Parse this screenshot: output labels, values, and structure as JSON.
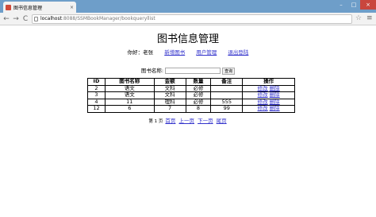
{
  "browser": {
    "tab_title": "图书信息管理",
    "tab_close": "×",
    "win_min": "–",
    "win_max": "□",
    "win_close": "×",
    "back": "←",
    "forward": "→",
    "reload": "C",
    "url_host": "localhost",
    "url_path": ":8088/SSMBookManager/bookqueryllist",
    "star": "☆",
    "menu": "≡"
  },
  "page": {
    "title": "图书信息管理",
    "greeting": "你好：老张",
    "links": [
      "新增图书",
      "用户管理",
      "退出登陆"
    ],
    "search_label": "图书名称:",
    "search_value": "",
    "search_button": "查询"
  },
  "table": {
    "headers": [
      "ID",
      "图书名称",
      "金额",
      "数量",
      "备注",
      "操作"
    ],
    "rows": [
      {
        "id": "2",
        "name": "语文",
        "amount": "文科",
        "qty": "必修",
        "note": "",
        "edit": "修改",
        "del": "删除"
      },
      {
        "id": "3",
        "name": "语文",
        "amount": "文科",
        "qty": "必修",
        "note": "",
        "edit": "修改",
        "del": "删除"
      },
      {
        "id": "4",
        "name": "11",
        "amount": "理科",
        "qty": "必修",
        "note": "555",
        "edit": "修改",
        "del": "删除"
      },
      {
        "id": "12",
        "name": "6",
        "amount": "7",
        "qty": "8",
        "note": "99",
        "edit": "修改",
        "del": "删除"
      }
    ]
  },
  "pager": {
    "info": "第 1 页",
    "first": "首页",
    "prev": "上一页",
    "next": "下一页",
    "last": "尾页"
  }
}
